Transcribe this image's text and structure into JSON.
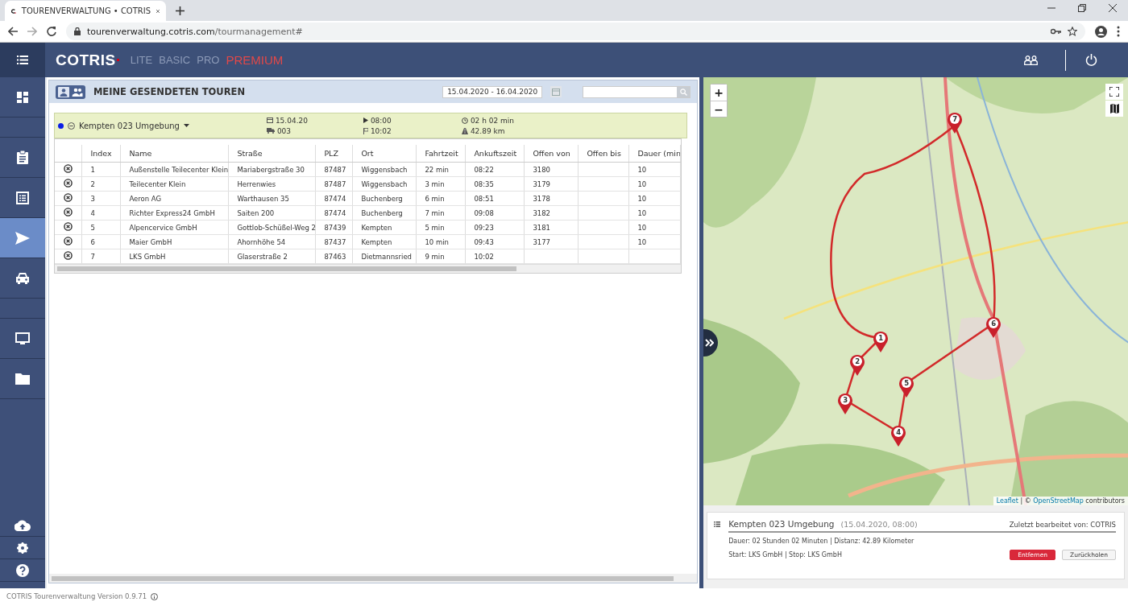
{
  "browser": {
    "tab_title": "TOURENVERWALTUNG • COTRIS",
    "url_host": "tourenverwaltung.cotris.com",
    "url_path": "/tourmanagement#"
  },
  "header": {
    "logo": "COTRIS",
    "editions": [
      {
        "label": "LITE",
        "selected": false
      },
      {
        "label": "BASIC",
        "selected": false
      },
      {
        "label": "PRO",
        "selected": false
      },
      {
        "label": "PREMIUM",
        "selected": true
      }
    ]
  },
  "sidebar": {
    "items": [
      {
        "kind": "dashboard",
        "selected": false
      },
      {
        "kind": "gap"
      },
      {
        "kind": "clipboard",
        "selected": false
      },
      {
        "kind": "list",
        "selected": false
      },
      {
        "kind": "send",
        "selected": true
      },
      {
        "kind": "car",
        "selected": false
      },
      {
        "kind": "gap"
      },
      {
        "kind": "monitor",
        "selected": false
      },
      {
        "kind": "folder",
        "selected": false
      }
    ],
    "bottom_items": [
      {
        "kind": "cloud"
      },
      {
        "kind": "gear"
      },
      {
        "kind": "help"
      }
    ]
  },
  "panel": {
    "title": "MEINE GESENDETEN TOUREN",
    "date_range": "15.04.2020 - 16.04.2020",
    "tour": {
      "color": "#0a1ee6",
      "name": "Kempten 023 Umgebung",
      "date": "15.04.20",
      "vehicle": "003",
      "start": "08:00",
      "end": "10:02",
      "duration": "02 h 02 min",
      "distance": "42.89 km"
    },
    "table": {
      "columns": [
        "Index",
        "Name",
        "Straße",
        "PLZ",
        "Ort",
        "Fahrtzeit",
        "Ankuftszeit",
        "Offen von",
        "Offen bis",
        "Dauer (min"
      ],
      "rows": [
        [
          "1",
          "Außenstelle Teilecenter Klein",
          "Mariabergstraße 30",
          "87487",
          "Wiggensbach",
          "22 min",
          "08:22",
          "3180",
          "",
          "10"
        ],
        [
          "2",
          "Teilecenter Klein",
          "Herrenwies",
          "87487",
          "Wiggensbach",
          "3 min",
          "08:35",
          "3179",
          "",
          "10"
        ],
        [
          "3",
          "Aeron AG",
          "Warthausen 35",
          "87474",
          "Buchenberg",
          "6 min",
          "08:51",
          "3178",
          "",
          "10"
        ],
        [
          "4",
          "Richter Express24 GmbH",
          "Saiten 200",
          "87474",
          "Buchenberg",
          "7 min",
          "09:08",
          "3182",
          "",
          "10"
        ],
        [
          "5",
          "Alpencervice GmbH",
          "Gottlob-Schüßel-Weg 2",
          "87439",
          "Kempten",
          "5 min",
          "09:23",
          "3181",
          "",
          "10"
        ],
        [
          "6",
          "Maier GmbH",
          "Ahornhöhe 54",
          "87437",
          "Kempten",
          "10 min",
          "09:43",
          "3177",
          "",
          "10"
        ],
        [
          "7",
          "LKS GmbH",
          "Glaserstraße 2",
          "87463",
          "Dietmannsried",
          "9 min",
          "10:02",
          "",
          "",
          ""
        ]
      ]
    }
  },
  "map": {
    "zoom_in": "+",
    "zoom_out": "−",
    "markers": [
      "1",
      "2",
      "3",
      "4",
      "5",
      "6",
      "7"
    ],
    "attribution_link": "Leaflet",
    "attribution_sep": "| ©",
    "attribution_osm": "OpenStreetMap",
    "attribution_rest": "contributors"
  },
  "info": {
    "title": "Kempten 023 Umgebung",
    "when": "(15.04.2020, 08:00)",
    "edited_by": "Zuletzt bearbeitet von: COTRIS",
    "summary": "Dauer: 02 Stunden 02 Minuten | Distanz: 42.89 Kilometer",
    "endpoints": "Start: LKS GmbH | Stop: LKS GmbH",
    "buttons": [
      {
        "kind": "danger",
        "label": "Entfernen"
      },
      {
        "kind": "plain",
        "label": "Zurückholen"
      }
    ]
  },
  "footer": "COTRIS Tourenverwaltung Version 0.9.71"
}
